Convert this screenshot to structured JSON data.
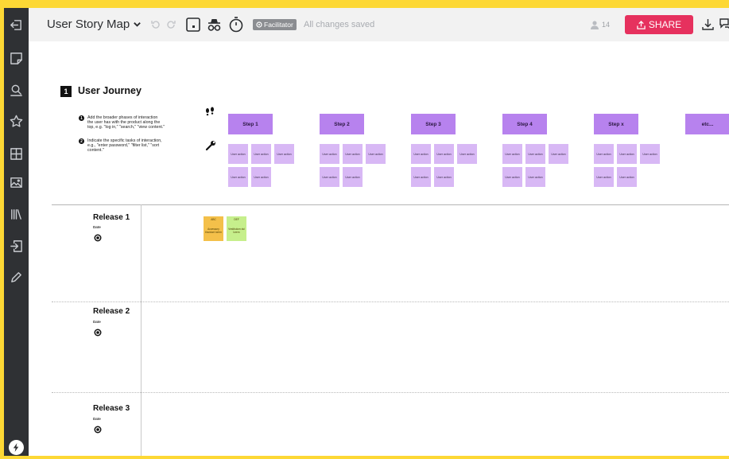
{
  "topbar": {
    "board_title": "User Story Map",
    "facilitator_label": "Facilitator",
    "save_status": "All changes saved",
    "user_count": "14",
    "share_label": "SHARE"
  },
  "sidebar": {
    "tools": [
      "exit-icon",
      "sticky-note-icon",
      "search-comment-icon",
      "star-icon",
      "grid-icon",
      "image-icon",
      "library-icon",
      "export-icon",
      "pen-icon"
    ],
    "footer": "lightning-icon"
  },
  "journey": {
    "number": "1",
    "title": "User Journey",
    "instructions": [
      {
        "num": "1",
        "lines": [
          "Add the broader phases of interaction",
          "the user has with the product along the",
          "top, e.g. \"log in,\" \"search,\" \"view content.\""
        ]
      },
      {
        "num": "2",
        "lines": [
          "Indicate the specific tasks of interaction,",
          "e.g., \"enter password,\" \"filter list,\" \"sort",
          "content.\""
        ]
      }
    ],
    "steps": [
      "Step 1",
      "Step 2",
      "Step 3",
      "Step 4",
      "Step x",
      "etc..."
    ],
    "action_label": "User action"
  },
  "releases": [
    {
      "title": "Release 1",
      "date_label": "Date"
    },
    {
      "title": "Release 2",
      "date_label": "Date"
    },
    {
      "title": "Release 3",
      "date_label": "Date"
    }
  ],
  "cards": [
    {
      "head": "ABC",
      "body": "Accessory tincidunt lorem",
      "color": "#f4c04a"
    },
    {
      "head": "DEF",
      "body": "Vestibulum dui lorem",
      "color": "#c6ef8c"
    }
  ],
  "colors": {
    "accent": "#e6315e",
    "step": "#b782ee",
    "action": "#d8b8f5",
    "frame": "#fdd835"
  }
}
